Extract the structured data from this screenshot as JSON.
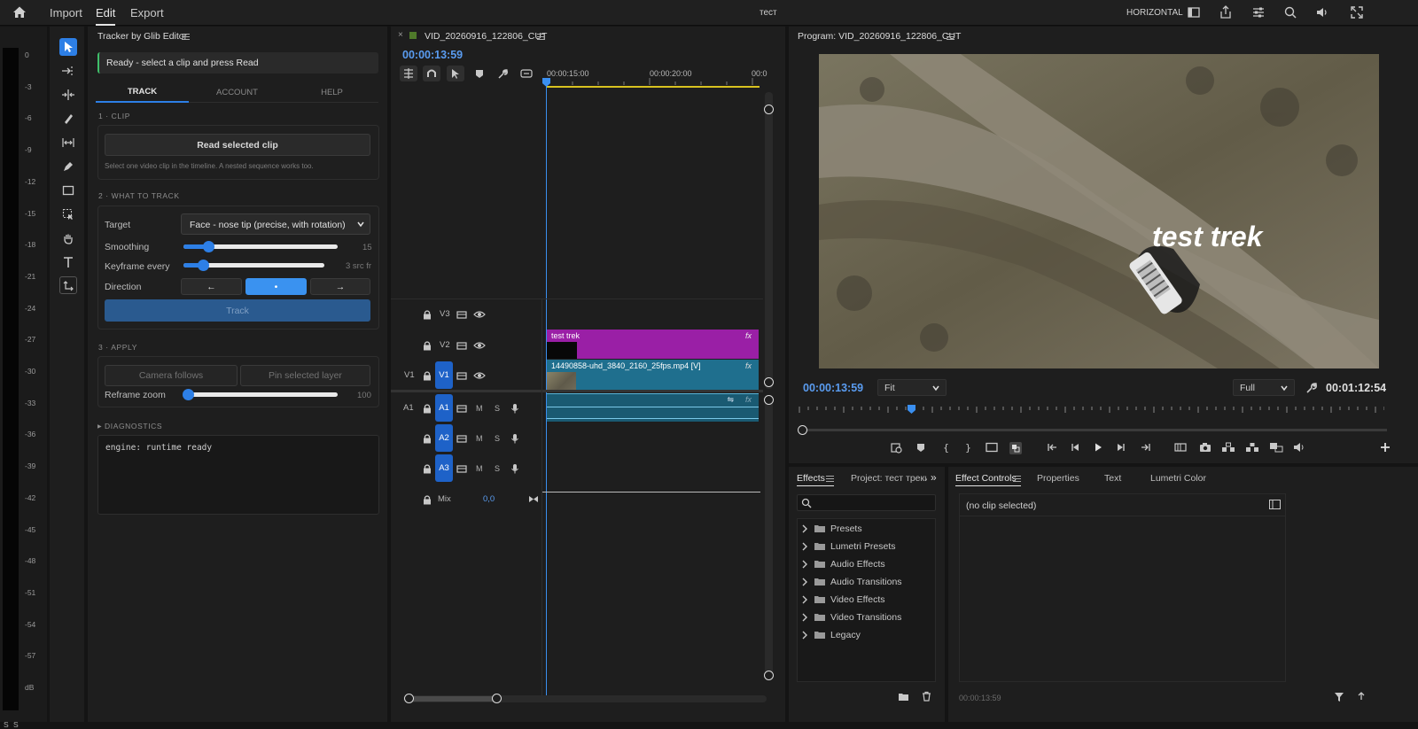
{
  "topbar": {
    "menu": [
      "Import",
      "Edit",
      "Export"
    ],
    "project_title": "тест",
    "workspace": "HORIZONTAL"
  },
  "meter": {
    "ticks": [
      "0",
      "-3",
      "-6",
      "-9",
      "-12",
      "-15",
      "-18",
      "-21",
      "-24",
      "-27",
      "-30",
      "-33",
      "-36",
      "-39",
      "-42",
      "-45",
      "-48",
      "-51",
      "-54",
      "-57",
      "dB"
    ],
    "solo": [
      "S",
      "S"
    ]
  },
  "tracker": {
    "title": "Tracker by Glib Editor",
    "status": "Ready - select a clip and press Read",
    "tabs": [
      "TRACK",
      "ACCOUNT",
      "HELP"
    ],
    "active_tab": "TRACK",
    "sec_clip": "1 · CLIP",
    "read_button": "Read selected clip",
    "read_hint": "Select one video clip in the timeline. A nested sequence works too.",
    "sec_track": "2 · WHAT TO TRACK",
    "target_label": "Target",
    "target_value": "Face - nose tip (precise, with rotation)",
    "smoothing_label": "Smoothing",
    "smoothing_value": "15",
    "smoothing_level": 0.16,
    "keyframe_label": "Keyframe every",
    "keyframe_value": "3 src fr",
    "keyframe_level": 0.14,
    "direction_label": "Direction",
    "direction_buttons": [
      "←",
      "•",
      "→"
    ],
    "track_button": "Track",
    "sec_apply": "3 · APPLY",
    "camera_button": "Camera follows",
    "pin_button": "Pin selected layer",
    "reframe_label": "Reframe zoom",
    "reframe_value": "100",
    "reframe_level": 0.0,
    "sec_diag": "DIAGNOSTICS",
    "diag_text": "engine: runtime ready",
    "accent": "#2d7fe6"
  },
  "timeline": {
    "tab_title": "VID_20260916_122806_CUT",
    "timecode": "00:00:13:59",
    "ruler": [
      "00:00:15:00",
      "00:00:20:00",
      "00:0"
    ],
    "tracks": {
      "v3": "V3",
      "v2": "V2",
      "v1_src": "V1",
      "v1": "V1",
      "a1_src": "A1",
      "a1": "A1",
      "a2": "A2",
      "a3": "A3",
      "m": "M",
      "s": "S",
      "mix": "Mix",
      "mix_value": "0,0"
    },
    "clip_title": "test trek",
    "clip_video": "14490858-uhd_3840_2160_25fps.mp4 [V]",
    "fx": "fx",
    "colors": {
      "title_clip": "#9a1fa6",
      "video_clip": "#1f6f8e",
      "audio_clip": "#1f6f8e"
    }
  },
  "program": {
    "title": "Program: VID_20260916_122806_CUT",
    "overlay_text": "test trek",
    "timecode": "00:00:13:59",
    "fit": "Fit",
    "quality": "Full",
    "duration": "00:01:12:54"
  },
  "effects": {
    "tabs": [
      "Effects",
      "Project: тест трекинг"
    ],
    "items": [
      "Presets",
      "Lumetri Presets",
      "Audio Effects",
      "Audio Transitions",
      "Video Effects",
      "Video Transitions",
      "Legacy"
    ]
  },
  "effect_controls": {
    "tabs": [
      "Effect Controls",
      "Properties",
      "Text",
      "Lumetri Color"
    ],
    "empty": "(no clip selected)",
    "timecode": "00:00:13:59"
  }
}
